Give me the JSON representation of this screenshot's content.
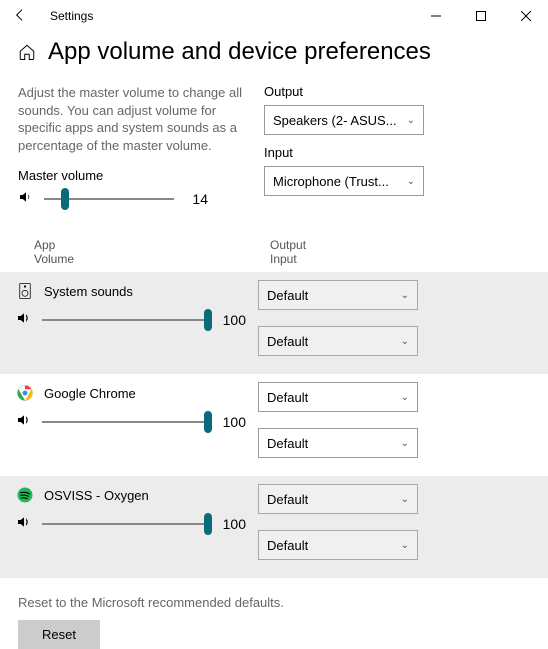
{
  "titlebar": {
    "app_name": "Settings"
  },
  "page_title": "App volume and device preferences",
  "description": "Adjust the master volume to change all sounds. You can adjust volume for specific apps and system sounds as a percentage of the master volume.",
  "master": {
    "label": "Master volume",
    "value": "14"
  },
  "output": {
    "label": "Output",
    "selected": "Speakers (2- ASUS..."
  },
  "input": {
    "label": "Input",
    "selected": "Microphone (Trust..."
  },
  "columns": {
    "app": "App",
    "volume": "Volume",
    "output": "Output",
    "input": "Input"
  },
  "apps": [
    {
      "name": "System sounds",
      "volume": "100",
      "output": "Default",
      "input": "Default"
    },
    {
      "name": "Google Chrome",
      "volume": "100",
      "output": "Default",
      "input": "Default"
    },
    {
      "name": "OSVISS - Oxygen",
      "volume": "100",
      "output": "Default",
      "input": "Default"
    }
  ],
  "reset": {
    "text": "Reset to the Microsoft recommended defaults.",
    "button": "Reset"
  }
}
